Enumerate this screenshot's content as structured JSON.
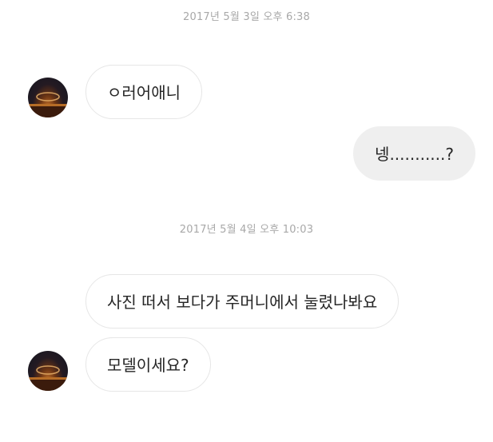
{
  "conversation": {
    "messages": [
      {
        "type": "timestamp",
        "text": "2017년 5월 3일 오후 6:38"
      },
      {
        "type": "incoming",
        "text": "ㅇ러어애니"
      },
      {
        "type": "outgoing",
        "text": "넹...........?"
      },
      {
        "type": "timestamp",
        "text": "2017년 5월 4일 오후 10:03"
      },
      {
        "type": "incoming",
        "text": "사진 떠서 보다가 주머니에서 눌렸나봐요"
      },
      {
        "type": "incoming",
        "text": "모델이세요?"
      }
    ],
    "avatar_icon": "profile-photo-sunset-icon"
  }
}
